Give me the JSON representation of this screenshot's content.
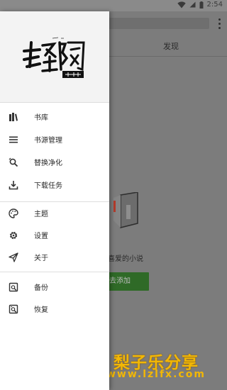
{
  "status_bar": {
    "time": "2:54"
  },
  "background": {
    "tab_label": "发现",
    "empty_text": "喜爱的小说",
    "add_button": "去添加"
  },
  "drawer": {
    "logo_title": "轻阅",
    "items": [
      {
        "label": "书库",
        "icon": "bookshelf-icon"
      },
      {
        "label": "书源管理",
        "icon": "list-icon"
      },
      {
        "label": "替换净化",
        "icon": "search-replace-icon"
      },
      {
        "label": "下载任务",
        "icon": "download-icon"
      },
      {
        "label": "主题",
        "icon": "palette-icon"
      },
      {
        "label": "设置",
        "icon": "gear-icon"
      },
      {
        "label": "关于",
        "icon": "send-icon"
      },
      {
        "label": "备份",
        "icon": "backup-icon"
      },
      {
        "label": "恢复",
        "icon": "restore-icon"
      }
    ]
  },
  "watermark": {
    "main": "梨子乐分享",
    "sub": "www.lzlfx.com"
  }
}
